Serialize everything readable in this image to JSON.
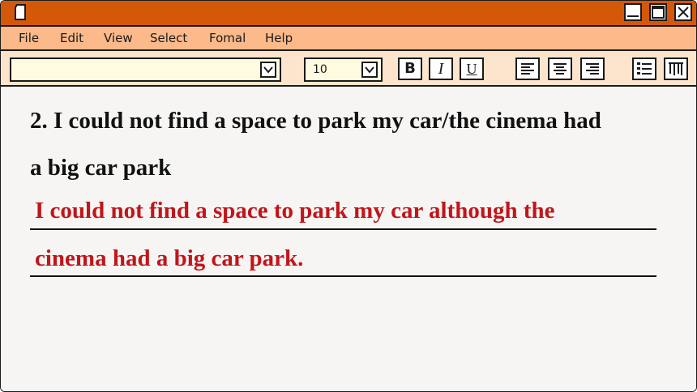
{
  "menu": [
    "File",
    "Edit",
    "View",
    "Select",
    "Fomal",
    "Help"
  ],
  "toolbar": {
    "font_name": "",
    "font_size": "10",
    "bold_label": "B",
    "italic_label": "I",
    "underline_label": "U"
  },
  "question": {
    "line1": "2. I could not find a space to park my car/the cinema had",
    "line2": "a big car park"
  },
  "answer": {
    "line1": "I could not find a space to park my car although the",
    "line2": "cinema had a big car park."
  },
  "colors": {
    "titlebar": "#d4580a",
    "menubar": "#fcb98a",
    "toolbar": "#fde4cd",
    "answer_text": "#c0161b"
  },
  "icons": {
    "window": "document-icon",
    "minimize": "minimize-icon",
    "maximize": "maximize-icon",
    "close": "close-icon",
    "align_left": "align-left-icon",
    "align_center": "align-center-icon",
    "align_right": "align-right-icon",
    "bullet_list": "bullet-list-icon",
    "columns": "columns-icon"
  }
}
